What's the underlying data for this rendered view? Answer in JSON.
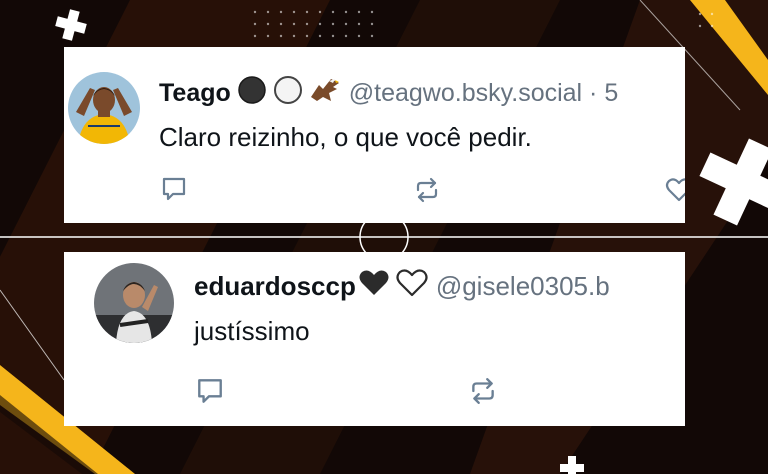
{
  "posts": [
    {
      "display_name": "Teago",
      "handle": "@teagwo.bsky.social · 5",
      "text": "Claro reizinho, o que você pedir.",
      "badges": [
        "black-circle-icon",
        "white-circle-icon",
        "eagle-icon"
      ],
      "actions": [
        "reply-icon",
        "repost-icon",
        "like-icon"
      ]
    },
    {
      "display_name": "eduardosccp",
      "handle": "@gisele0305.b",
      "text": "justíssimo",
      "badges": [
        "black-heart-icon",
        "white-heart-icon"
      ],
      "actions": [
        "reply-icon",
        "repost-icon"
      ]
    }
  ],
  "colors": {
    "background": "#120806",
    "accent": "#f5b51b",
    "card": "#ffffff",
    "name": "#0f1419",
    "handle": "#66727f",
    "action_icon": "#6a7f94"
  }
}
